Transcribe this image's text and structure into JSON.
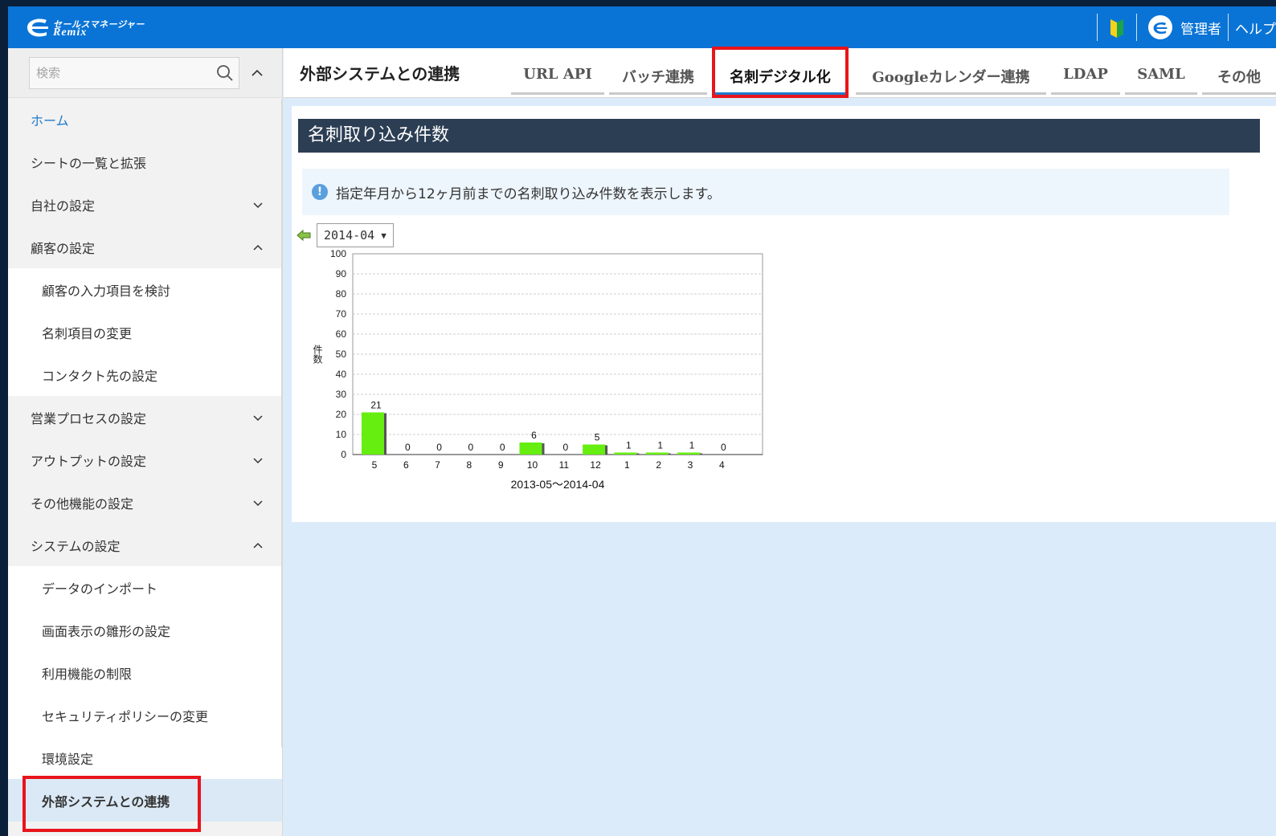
{
  "header": {
    "logo_top": "セールスマネージャー",
    "logo_bottom": "Remix",
    "admin_label": "管理者",
    "help_label": "ヘルプ"
  },
  "sidebar": {
    "search_placeholder": "検索",
    "items": [
      {
        "label": "ホーム",
        "level": "top",
        "home": true
      },
      {
        "label": "シートの一覧と拡張",
        "level": "top"
      },
      {
        "label": "自社の設定",
        "level": "top",
        "chevron": "down"
      },
      {
        "label": "顧客の設定",
        "level": "top",
        "chevron": "up"
      },
      {
        "label": "顧客の入力項目を検討",
        "level": "sub"
      },
      {
        "label": "名刺項目の変更",
        "level": "sub"
      },
      {
        "label": "コンタクト先の設定",
        "level": "sub"
      },
      {
        "label": "営業プロセスの設定",
        "level": "top",
        "chevron": "down"
      },
      {
        "label": "アウトプットの設定",
        "level": "top",
        "chevron": "down"
      },
      {
        "label": "その他機能の設定",
        "level": "top",
        "chevron": "down"
      },
      {
        "label": "システムの設定",
        "level": "top",
        "chevron": "up"
      },
      {
        "label": "データのインポート",
        "level": "sub"
      },
      {
        "label": "画面表示の雛形の設定",
        "level": "sub"
      },
      {
        "label": "利用機能の制限",
        "level": "sub"
      },
      {
        "label": "セキュリティポリシーの変更",
        "level": "sub"
      },
      {
        "label": "環境設定",
        "level": "sub"
      },
      {
        "label": "外部システムとの連携",
        "level": "sub",
        "active": true
      }
    ]
  },
  "page": {
    "title": "外部システムとの連携",
    "tabs": [
      "URL API",
      "バッチ連携",
      "名刺デジタル化",
      "Googleカレンダー連携",
      "LDAP",
      "SAML",
      "その他"
    ],
    "active_tab": 2
  },
  "section": {
    "heading": "名刺取り込み件数",
    "info": "指定年月から12ヶ月前までの名刺取り込み件数を表示します。",
    "selected_month": "2014-04"
  },
  "colors": {
    "header_blue": "#0a74d6",
    "bar_green": "#66ee11",
    "section_head": "#2c3e54",
    "highlight_red": "#e8141c"
  },
  "chart_data": {
    "type": "bar",
    "categories": [
      "5",
      "6",
      "7",
      "8",
      "9",
      "10",
      "11",
      "12",
      "1",
      "2",
      "3",
      "4"
    ],
    "values": [
      21,
      0,
      0,
      0,
      0,
      6,
      0,
      5,
      1,
      1,
      1,
      0
    ],
    "ylabel": "件数",
    "xlabel": "2013-05～2014-04",
    "ylim": [
      0,
      100
    ],
    "yticks": [
      0,
      10,
      20,
      30,
      40,
      50,
      60,
      70,
      80,
      90,
      100
    ],
    "grid": true,
    "data_labels": true
  }
}
